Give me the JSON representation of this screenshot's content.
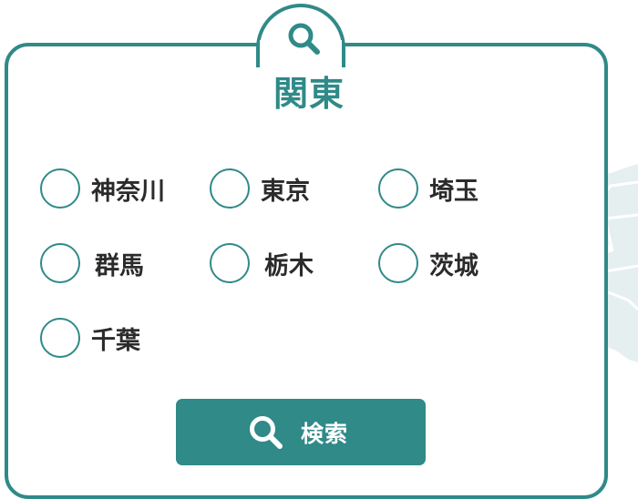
{
  "theme": {
    "accent": "#2f8a88",
    "map": "#e6efef",
    "text": "#2b2b2b"
  },
  "header": {
    "icon": "search-icon",
    "title": "関東"
  },
  "prefectures": [
    {
      "label": "神奈川",
      "checked": false
    },
    {
      "label": "東京",
      "checked": false
    },
    {
      "label": "埼玉",
      "checked": false
    },
    {
      "label": "群馬",
      "checked": false
    },
    {
      "label": "栃木",
      "checked": false
    },
    {
      "label": "茨城",
      "checked": false
    },
    {
      "label": "千葉",
      "checked": false
    }
  ],
  "search_button": {
    "icon": "search-icon",
    "label": "検索"
  }
}
